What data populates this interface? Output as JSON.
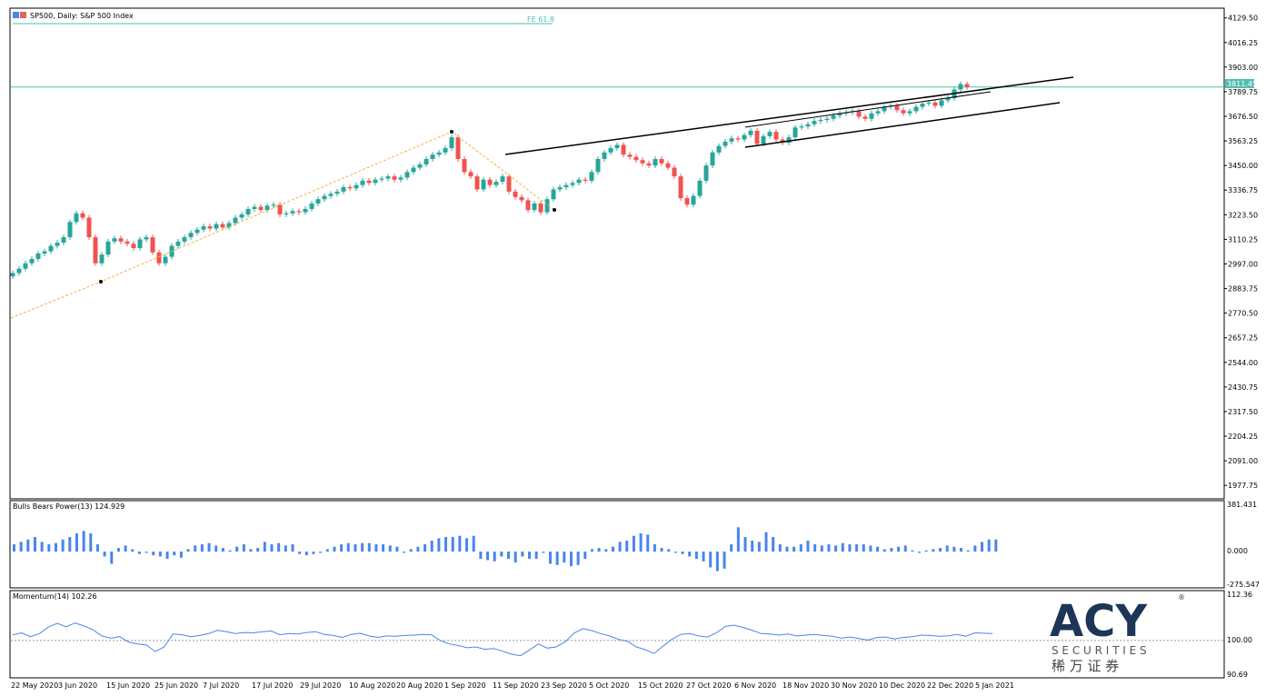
{
  "header": {
    "title": "SP500, Daily:  S&P 500 Index"
  },
  "fib_label": "FE 61.8",
  "price_box": "3811.45",
  "indicators": {
    "bulls_bears_label": "Bulls Bears Power(13) 124.929",
    "momentum_label": "Momentum(14) 102.26"
  },
  "logo": {
    "brand": "ACY",
    "registered": "®",
    "sub": "S E C U R I T I E S",
    "chinese": "稀  万  证  券",
    "colors": {
      "navy": "#1d3557",
      "text": "#555555"
    }
  },
  "colors": {
    "up": "#26a69a",
    "down": "#ef5350",
    "histogram": "#4a86e8",
    "momentum_line": "#4a86e8",
    "trend": "#000000",
    "fib": "#f5b041",
    "price_line": "#4fbfb0"
  },
  "chart_data": [
    {
      "type": "candlestick",
      "title": "SP500, Daily:  S&P 500 Index",
      "y_ticks": [
        "4129.50",
        "4016.25",
        "3903.00",
        "3789.75",
        "3676.50",
        "3563.25",
        "3450.00",
        "3336.75",
        "3223.50",
        "3110.25",
        "2997.00",
        "2883.75",
        "2770.50",
        "2657.25",
        "2544.00",
        "2430.75",
        "2317.50",
        "2204.25",
        "2091.00",
        "1977.75"
      ],
      "ylim": [
        1920.0,
        4170.0
      ],
      "x_ticks": [
        "22 May 2020",
        "3 Jun 2020",
        "15 Jun 2020",
        "25 Jun 2020",
        "7 Jul 2020",
        "17 Jul 2020",
        "29 Jul 2020",
        "10 Aug 2020",
        "20 Aug 2020",
        "1 Sep 2020",
        "11 Sep 2020",
        "23 Sep 2020",
        "5 Oct 2020",
        "15 Oct 2020",
        "27 Oct 2020",
        "6 Nov 2020",
        "18 Nov 2020",
        "30 Nov 2020",
        "10 Dec 2020",
        "22 Dec 2020",
        "5 Jan 2021"
      ],
      "close": [
        2955,
        2975,
        3000,
        3020,
        3045,
        3055,
        3080,
        3095,
        3120,
        3190,
        3230,
        3210,
        3120,
        3000,
        3040,
        3100,
        3115,
        3100,
        3090,
        3070,
        3110,
        3120,
        3050,
        3000,
        3030,
        3080,
        3100,
        3120,
        3140,
        3155,
        3170,
        3160,
        3180,
        3165,
        3185,
        3210,
        3225,
        3250,
        3260,
        3245,
        3265,
        3270,
        3225,
        3230,
        3240,
        3235,
        3250,
        3275,
        3295,
        3310,
        3320,
        3330,
        3350,
        3345,
        3360,
        3380,
        3370,
        3385,
        3390,
        3400,
        3385,
        3395,
        3420,
        3440,
        3455,
        3480,
        3500,
        3510,
        3530,
        3580,
        3480,
        3420,
        3400,
        3340,
        3385,
        3360,
        3375,
        3400,
        3330,
        3305,
        3290,
        3245,
        3275,
        3235,
        3295,
        3340,
        3350,
        3360,
        3370,
        3385,
        3380,
        3420,
        3480,
        3510,
        3530,
        3545,
        3500,
        3490,
        3475,
        3460,
        3450,
        3480,
        3460,
        3440,
        3400,
        3300,
        3270,
        3310,
        3380,
        3450,
        3510,
        3540,
        3560,
        3575,
        3570,
        3590,
        3610,
        3550,
        3585,
        3605,
        3570,
        3555,
        3580,
        3625,
        3630,
        3640,
        3655,
        3660,
        3665,
        3680,
        3690,
        3695,
        3700,
        3675,
        3665,
        3690,
        3700,
        3720,
        3725,
        3705,
        3690,
        3700,
        3720,
        3735,
        3740,
        3725,
        3750,
        3760,
        3800,
        3825,
        3811
      ],
      "open": [
        2940,
        2955,
        2975,
        3000,
        3020,
        3045,
        3055,
        3080,
        3095,
        3120,
        3190,
        3230,
        3210,
        3120,
        3000,
        3040,
        3100,
        3115,
        3100,
        3090,
        3070,
        3110,
        3120,
        3050,
        3000,
        3030,
        3080,
        3100,
        3120,
        3140,
        3155,
        3170,
        3160,
        3180,
        3165,
        3185,
        3210,
        3225,
        3250,
        3260,
        3245,
        3265,
        3270,
        3225,
        3230,
        3240,
        3235,
        3250,
        3275,
        3295,
        3310,
        3320,
        3330,
        3350,
        3345,
        3360,
        3380,
        3370,
        3385,
        3390,
        3400,
        3385,
        3395,
        3420,
        3440,
        3455,
        3480,
        3500,
        3510,
        3530,
        3580,
        3480,
        3420,
        3400,
        3340,
        3385,
        3360,
        3375,
        3400,
        3330,
        3305,
        3290,
        3245,
        3275,
        3235,
        3295,
        3340,
        3350,
        3360,
        3370,
        3385,
        3380,
        3420,
        3480,
        3510,
        3530,
        3545,
        3500,
        3490,
        3475,
        3460,
        3450,
        3480,
        3460,
        3440,
        3400,
        3300,
        3270,
        3310,
        3380,
        3450,
        3510,
        3540,
        3560,
        3575,
        3570,
        3590,
        3610,
        3550,
        3585,
        3605,
        3570,
        3555,
        3580,
        3625,
        3630,
        3640,
        3655,
        3660,
        3665,
        3680,
        3690,
        3695,
        3700,
        3675,
        3665,
        3690,
        3700,
        3720,
        3725,
        3705,
        3690,
        3700,
        3720,
        3735,
        3740,
        3725,
        3750,
        3760,
        3800,
        3825
      ],
      "bulls_bears": [
        60,
        80,
        100,
        120,
        80,
        60,
        70,
        100,
        120,
        150,
        170,
        150,
        60,
        -40,
        -100,
        30,
        50,
        20,
        -20,
        -10,
        -30,
        -40,
        -60,
        -30,
        -50,
        20,
        50,
        60,
        70,
        50,
        30,
        10,
        40,
        60,
        20,
        30,
        80,
        60,
        70,
        50,
        60,
        -20,
        -30,
        -20,
        -10,
        20,
        40,
        60,
        70,
        60,
        70,
        70,
        60,
        60,
        50,
        40,
        -10,
        20,
        40,
        60,
        90,
        110,
        120,
        120,
        130,
        110,
        130,
        -60,
        -70,
        -80,
        -40,
        -60,
        -90,
        -40,
        -60,
        -60,
        -10,
        -100,
        -110,
        -90,
        -120,
        -110,
        -60,
        20,
        30,
        20,
        40,
        80,
        90,
        130,
        150,
        140,
        60,
        30,
        20,
        -10,
        -20,
        -40,
        -60,
        -80,
        -130,
        -160,
        -140,
        60,
        200,
        120,
        90,
        80,
        160,
        120,
        60,
        40,
        40,
        60,
        90,
        60,
        50,
        60,
        50,
        70,
        60,
        60,
        60,
        50,
        40,
        20,
        30,
        40,
        50,
        10,
        -10,
        10,
        20,
        30,
        50,
        40,
        30,
        10,
        50,
        80,
        100,
        100
      ],
      "momentum": [
        101.5,
        102.0,
        101.0,
        101.8,
        103.5,
        104.5,
        103.6,
        104.6,
        103.8,
        102.8,
        101.2,
        100.6,
        101.0,
        99.6,
        99.1,
        98.8,
        97.1,
        98.3,
        101.7,
        101.5,
        101.0,
        101.3,
        101.8,
        102.7,
        102.3,
        101.8,
        102.1,
        102.0,
        102.3,
        102.5,
        101.5,
        101.8,
        101.7,
        102.1,
        102.3,
        101.6,
        101.3,
        100.8,
        101.6,
        101.9,
        101.2,
        100.8,
        101.2,
        101.1,
        101.3,
        101.4,
        101.6,
        101.5,
        100.0,
        99.1,
        98.7,
        98.1,
        98.3,
        97.7,
        97.9,
        97.2,
        96.4,
        96.0,
        97.5,
        99.1,
        98.0,
        98.3,
        99.6,
        101.9,
        103.1,
        102.6,
        101.8,
        101.2,
        100.3,
        99.8,
        98.3,
        97.6,
        96.6,
        98.5,
        100.3,
        101.6,
        101.8,
        101.2,
        100.9,
        102.0,
        103.7,
        104.0,
        103.4,
        102.7,
        101.8,
        101.7,
        101.4,
        101.7,
        101.2,
        101.4,
        101.6,
        101.3,
        101.1,
        100.6,
        100.9,
        100.5,
        100.1,
        100.8,
        100.9,
        100.4,
        100.8,
        101.0,
        101.4,
        101.3,
        101.1,
        101.2,
        101.6,
        101.1,
        102.0,
        101.9,
        101.8
      ]
    }
  ]
}
